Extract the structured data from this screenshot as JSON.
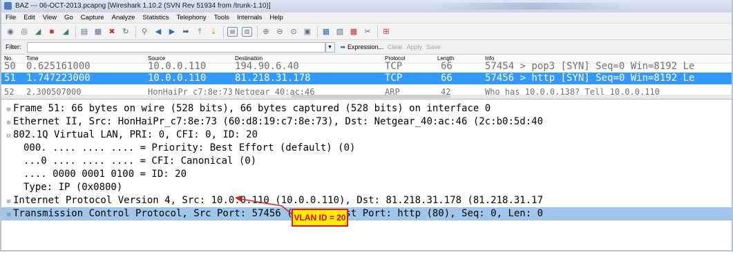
{
  "window": {
    "title": "BAZ --- 06-OCT-2013.pcapng  [Wireshark 1.10.2  (SVN Rev 51934 from /trunk-1.10)]"
  },
  "menu": [
    "File",
    "Edit",
    "View",
    "Go",
    "Capture",
    "Analyze",
    "Statistics",
    "Telephony",
    "Tools",
    "Internals",
    "Help"
  ],
  "toolbar_icons": [
    "interface-list-icon",
    "capture-options-icon",
    "start-capture-icon",
    "stop-capture-icon",
    "restart-capture-icon",
    "open-file-icon",
    "save-file-icon",
    "close-file-icon",
    "reload-icon",
    "find-packet-icon",
    "go-back-icon",
    "go-forward-icon",
    "go-to-packet-icon",
    "go-first-icon",
    "go-last-icon",
    "colorize-icon",
    "auto-scroll-icon",
    "zoom-in-icon",
    "zoom-out-icon",
    "zoom-normal-icon",
    "resize-columns-icon",
    "capture-filters-icon",
    "display-filters-icon",
    "coloring-rules-icon",
    "preferences-icon",
    "help-icon"
  ],
  "filter": {
    "label": "Filter:",
    "value": "",
    "expression": "Expression...",
    "clear": "Clear",
    "apply": "Apply",
    "save": "Save"
  },
  "packet_list": {
    "columns": {
      "no": "No.",
      "time": "Time",
      "source": "Source",
      "destination": "Destination",
      "protocol": "Protocol",
      "length": "Length",
      "info": "Info"
    },
    "rows": [
      {
        "no": "50",
        "time": "0.625161000",
        "source": "10.0.0.110",
        "destination": "194.90.6.40",
        "protocol": "TCP",
        "length": "66",
        "info": "57454 > pop3 [SYN] Seq=0 Win=8192 Le"
      },
      {
        "no": "51",
        "time": "1.747223000",
        "source": "10.0.0.110",
        "destination": "81.218.31.178",
        "protocol": "TCP",
        "length": "66",
        "info": "57456 > http [SYN] Seq=0 Win=8192 Le"
      },
      {
        "no": "52",
        "time": "2.300507000",
        "source": "HonHaiPr_c7:8e:73",
        "destination": "Netgear_40:ac:46",
        "protocol": "ARP",
        "length": "42",
        "info": "Who has 10.0.0.138?  Tell 10.0.0.110"
      }
    ]
  },
  "details": {
    "frame": "Frame 51: 66 bytes on wire (528 bits), 66 bytes captured (528 bits) on interface 0",
    "ethernet": "Ethernet II, Src: HonHaiPr_c7:8e:73 (60:d8:19:c7:8e:73), Dst: Netgear_40:ac:46 (2c:b0:5d:40",
    "vlan": "802.1Q Virtual LAN, PRI: 0, CFI: 0, ID: 20",
    "priority": "000. .... .... .... = Priority: Best Effort (default) (0)",
    "cfi": "...0 .... .... .... = CFI: Canonical (0)",
    "id": ".... 0000 0001 0100 = ID: 20",
    "type": "Type: IP (0x0800)",
    "ip": "Internet Protocol Version 4, Src: 10.0.0.110 (10.0.0.110), Dst: 81.218.31.178 (81.218.31.17",
    "tcp": "Transmission Control Protocol, Src Port: 57456 (57456), Dst Port: http (80), Seq: 0, Len: 0"
  },
  "annotation": {
    "label": "VLAN ID = 20"
  },
  "colors": {
    "selected_row": "#3399ff",
    "tcp_highlight": "#9fc7ec",
    "callout_fill": "#ffec00",
    "callout_border": "#e11b1b"
  }
}
